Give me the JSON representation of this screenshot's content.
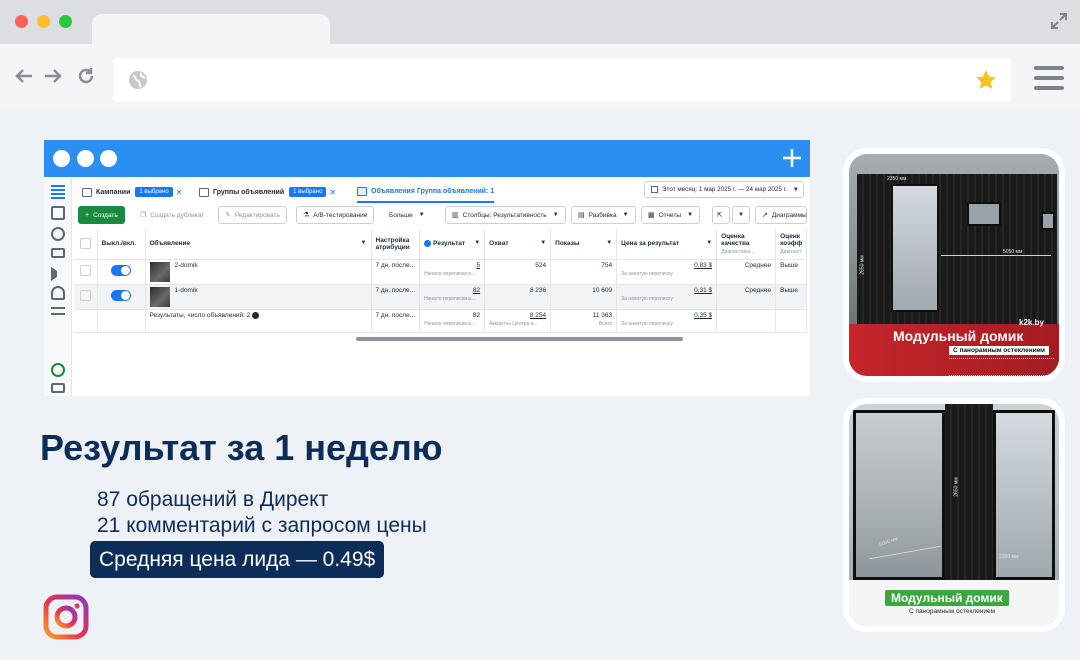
{
  "ads_manager": {
    "tabs": [
      {
        "label": "Кампании",
        "badge": "1 выбрано"
      },
      {
        "label": "Группы объявлений",
        "badge": "1 выбрано"
      },
      {
        "label": "Объявления Группа объявлений: 1"
      }
    ],
    "date_range": "Этот месяц: 1 мар 2025 г. — 24 мар 2025 г.",
    "actions": {
      "create": "Создать",
      "duplicate": "Создать дубликат",
      "edit": "Редактировать",
      "ab_test": "A/B-тестирование",
      "more": "Больше",
      "columns": "Столбцы: Результативность",
      "breakdown": "Разбивка",
      "reports": "Отчеты",
      "charts": "Диаграммы"
    },
    "columns": {
      "toggle": "Выкл./вкл.",
      "ad": "Объявление",
      "attribution": "Настройка атрибуции",
      "result": "Результат",
      "reach": "Охват",
      "impressions": "Показы",
      "cost_per_result": "Цена за результат",
      "quality": "Оценка качества",
      "quality_sub": "Диагностика...",
      "coef": "Оценк коэфф",
      "coef_sub": "Диагност"
    },
    "rows": [
      {
        "name": "2-domik",
        "attribution": "7 дн. после...",
        "result": "5",
        "result_sub": "Начало переписки в...",
        "reach": "524",
        "impressions": "754",
        "cpr": "0,83 $",
        "cpr_sub": "За начатую переписку",
        "quality": "Среднее",
        "coef": "Выше"
      },
      {
        "name": "1-domik",
        "attribution": "7 дн. после...",
        "result": "82",
        "result_sub": "Начало переписки в...",
        "reach": "8 236",
        "impressions": "10 609",
        "cpr": "0,31 $",
        "cpr_sub": "За начатую переписку",
        "quality": "Среднее",
        "coef": "Выше"
      }
    ],
    "summary": {
      "label": "Результаты, число объявлений: 2",
      "attribution": "7 дн. после...",
      "result": "82",
      "result_sub": "Начало переписки в...",
      "reach": "8 254",
      "reach_sub": "Аккаунты Центра а...",
      "impressions": "11 363",
      "impressions_sub": "Всего",
      "cpr": "0,35 $",
      "cpr_sub": "За начатую переписку"
    }
  },
  "results": {
    "headline": "Результат за 1 неделю",
    "line1": "87 обращений в Директ",
    "line2": "21 комментарий с запросом цены",
    "highlight": "Средняя цена лида — 0.49$"
  },
  "creatives": [
    {
      "brand": "k2k.by",
      "title": "Модульный домик",
      "subtitle": "С панорамным остеклением",
      "dims": [
        "2350 мм",
        "5050 мм",
        "2650 мм"
      ]
    },
    {
      "title": "Модульный домик",
      "subtitle": "С панорамным остеклением",
      "dims": [
        "2650 мм",
        "5050 мм",
        "2350 мм"
      ]
    }
  ],
  "icons": [
    "expand-icon",
    "back-icon",
    "forward-icon",
    "reload-icon",
    "globe-icon",
    "star-icon",
    "menu-icon",
    "plus-icon",
    "instagram-icon"
  ],
  "colors": {
    "accent": "#1877f2",
    "titlebar": "#2b8ff2",
    "heading": "#0d2d59",
    "create_btn": "#1b8a3e",
    "star": "#f7c32b"
  }
}
